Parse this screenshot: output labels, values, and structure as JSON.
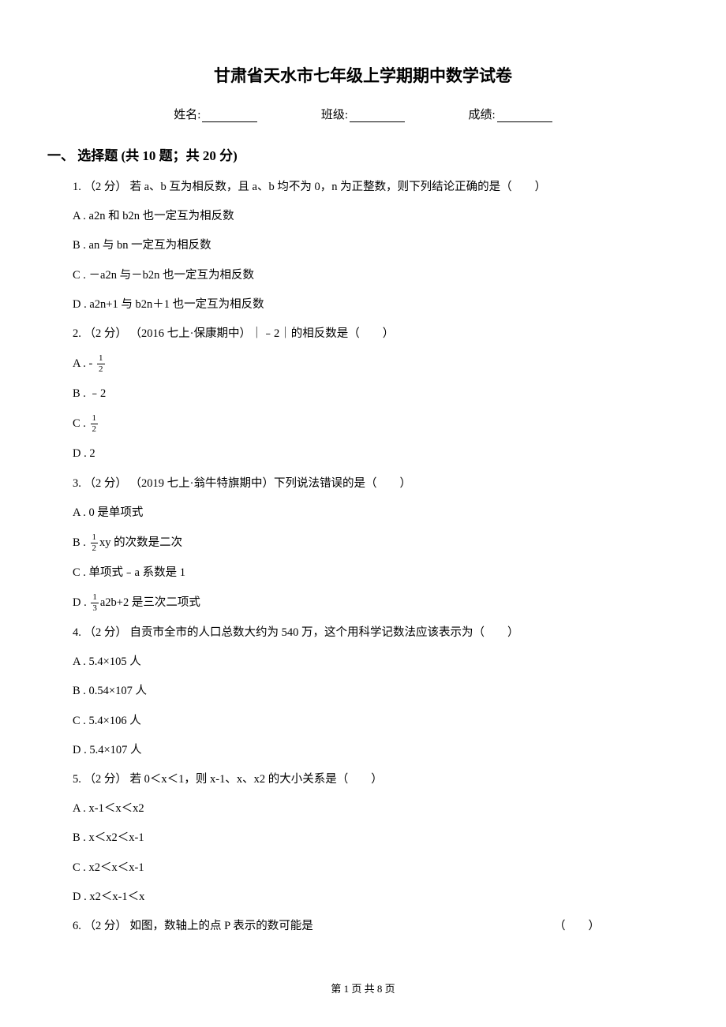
{
  "title": "甘肃省天水市七年级上学期期中数学试卷",
  "info": {
    "name_label": "姓名:",
    "class_label": "班级:",
    "score_label": "成绩:"
  },
  "section1": {
    "heading": "一、 选择题 (共 10 题；共 20 分)"
  },
  "q1": {
    "stem": "1. （2 分） 若 a、b 互为相反数，且 a、b 均不为 0，n 为正整数，则下列结论正确的是（　　）",
    "A": "A .  a2n 和 b2n 也一定互为相反数",
    "B": "B .  an 与 bn 一定互为相反数",
    "C": "C .  －a2n 与－b2n 也一定互为相反数",
    "D": "D .  a2n+1 与 b2n＋1 也一定互为相反数"
  },
  "q2": {
    "stem": "2. （2 分） （2016 七上·保康期中）｜﹣2｜的相反数是（　　）",
    "A_prefix": "A .  - ",
    "B": "B .  ﹣2",
    "C_prefix": "C .  ",
    "D": "D .  2"
  },
  "q3": {
    "stem": "3. （2 分） （2019 七上·翁牛特旗期中）下列说法错误的是（　　）",
    "A": "A .  0 是单项式",
    "B_prefix": "B .  ",
    "B_suffix": "xy 的次数是二次",
    "C": "C .  单项式﹣a 系数是 1",
    "D_prefix": "D .  ",
    "D_suffix": "a2b+2 是三次二项式"
  },
  "q4": {
    "stem": "4. （2 分） 自贡市全市的人口总数大约为 540 万，这个用科学记数法应该表示为（　　）",
    "A": "A .  5.4×105 人",
    "B": "B .  0.54×107 人",
    "C": "C .  5.4×106 人",
    "D": "D .  5.4×107 人"
  },
  "q5": {
    "stem": "5. （2 分） 若 0＜x＜1，则 x-1、x、x2 的大小关系是（　　）",
    "A": "A .  x-1＜x＜x2",
    "B": "B .  x＜x2＜x-1",
    "C": "C .  x2＜x＜x-1",
    "D": "D .  x2＜x-1＜x"
  },
  "q6": {
    "stem_left": "6. （2 分） 如图，数轴上的点 P 表示的数可能是",
    "stem_right": "（　　）"
  },
  "frac12": {
    "num": "1",
    "den": "2"
  },
  "frac13": {
    "num": "1",
    "den": "3"
  },
  "footer": "第 1 页 共 8 页"
}
